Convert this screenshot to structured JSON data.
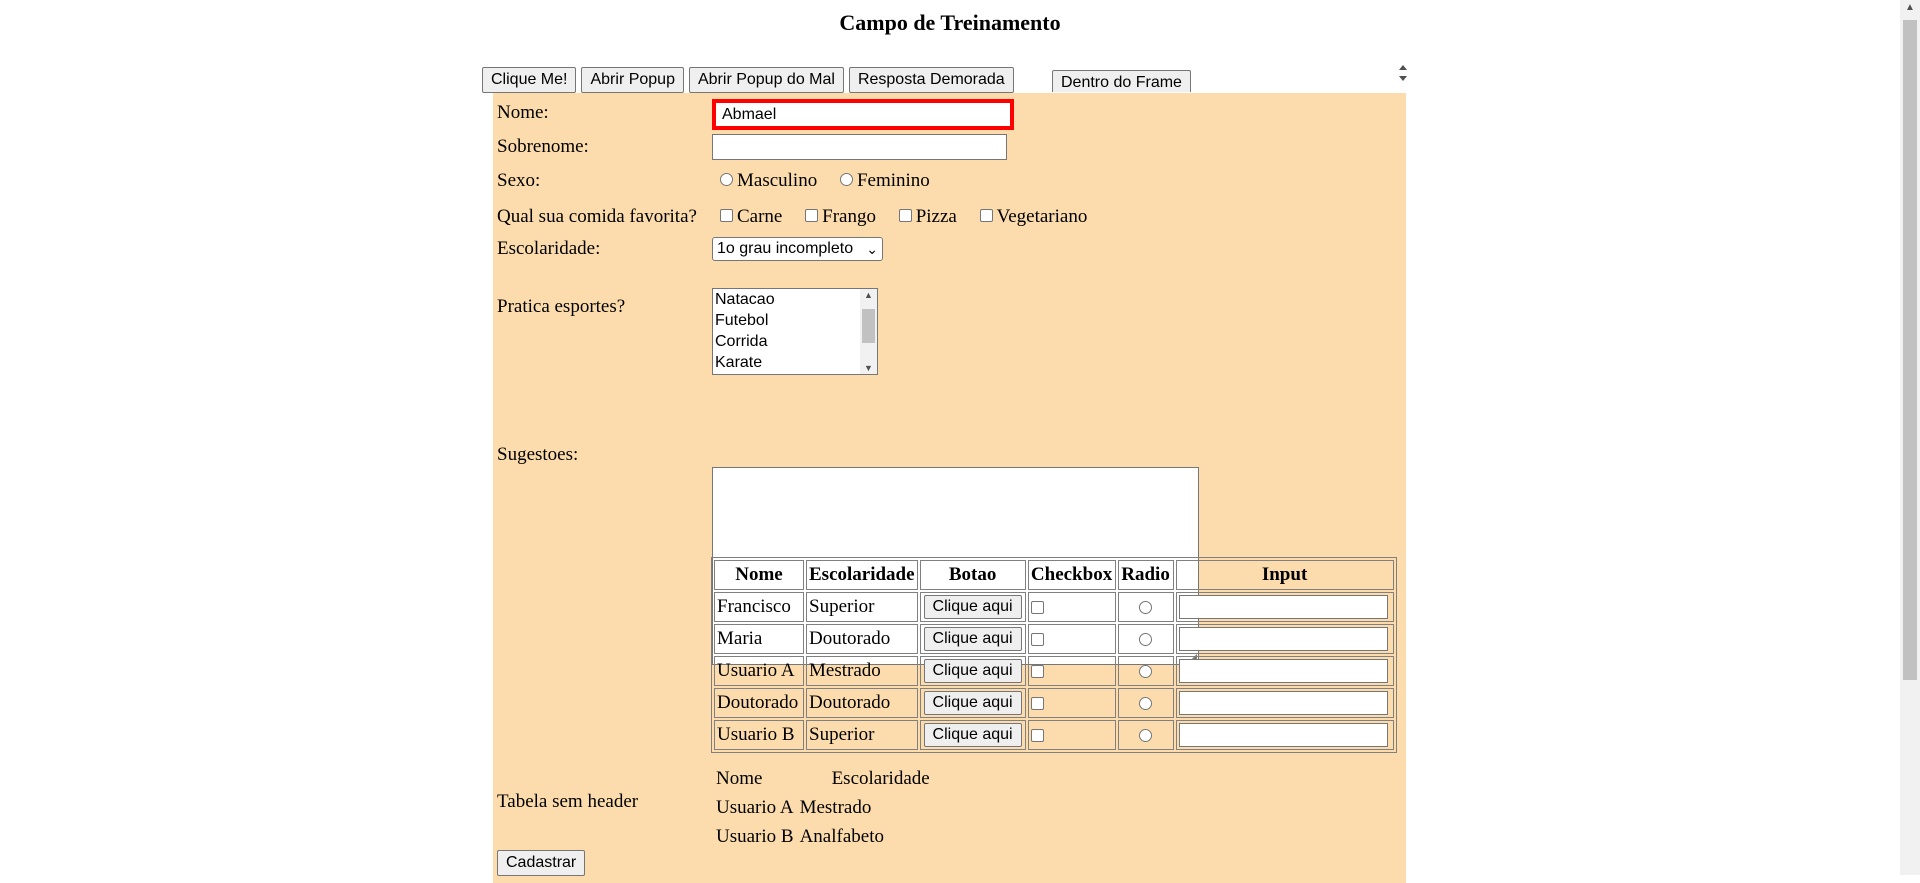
{
  "page": {
    "title": "Campo de Treinamento"
  },
  "toolbar": {
    "buttons": [
      "Clique Me!",
      "Abrir Popup",
      "Abrir Popup do Mal",
      "Resposta Demorada"
    ],
    "frame_button": "Dentro do Frame"
  },
  "form": {
    "nome": {
      "label": "Nome:",
      "value": "Abmael"
    },
    "sobrenome": {
      "label": "Sobrenome:",
      "value": ""
    },
    "sexo": {
      "label": "Sexo:",
      "options": [
        "Masculino",
        "Feminino"
      ]
    },
    "comida": {
      "label": "Qual sua comida favorita?",
      "options": [
        "Carne",
        "Frango",
        "Pizza",
        "Vegetariano"
      ]
    },
    "escolaridade": {
      "label": "Escolaridade:",
      "selected": "1o grau incompleto"
    },
    "esportes": {
      "label": "Pratica esportes?",
      "options": [
        "Natacao",
        "Futebol",
        "Corrida",
        "Karate"
      ]
    },
    "sugestoes": {
      "label": "Sugestoes:",
      "value": ""
    },
    "submit": "Cadastrar"
  },
  "users_table": {
    "headers": [
      "Nome",
      "Escolaridade",
      "Botao",
      "Checkbox",
      "Radio",
      "Input"
    ],
    "button_label": "Clique aqui",
    "rows": [
      {
        "nome": "Francisco",
        "escolaridade": "Superior"
      },
      {
        "nome": "Maria",
        "escolaridade": "Doutorado"
      },
      {
        "nome": "Usuario A",
        "escolaridade": "Mestrado"
      },
      {
        "nome": "Doutorado",
        "escolaridade": "Doutorado"
      },
      {
        "nome": "Usuario B",
        "escolaridade": "Superior"
      }
    ]
  },
  "no_header_table": {
    "label": "Tabela sem header",
    "rows": [
      [
        "Nome",
        "Escolaridade"
      ],
      [
        "Usuario A",
        "Mestrado"
      ],
      [
        "Usuario B",
        "Analfabeto"
      ]
    ]
  },
  "colors": {
    "form_background": "#fcdcac",
    "highlight_border": "#ff0000"
  }
}
